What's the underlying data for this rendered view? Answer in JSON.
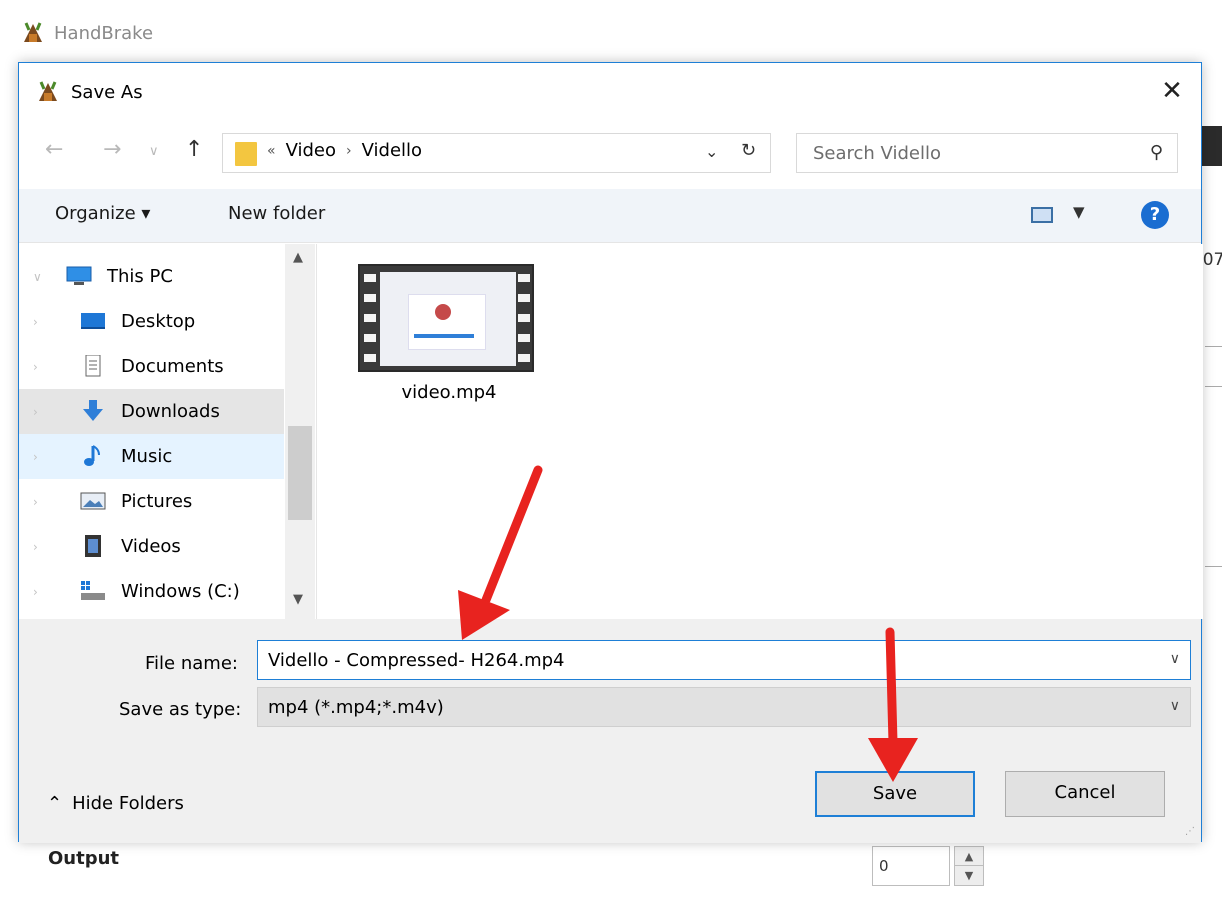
{
  "background_app": {
    "title": "HandBrake",
    "edge_text": ":07",
    "output_label": "Output",
    "spinner_value": "0"
  },
  "dialog": {
    "title": "Save As",
    "address": {
      "crumb_prefix": "«",
      "crumbs": [
        "Video",
        "Vidello"
      ]
    },
    "search_placeholder": "Search Vidello",
    "toolbar": {
      "organize": "Organize ▾",
      "new_folder": "New folder"
    },
    "tree": [
      {
        "label": "This PC",
        "icon": "monitor-icon"
      },
      {
        "label": "Desktop",
        "icon": "desktop-icon"
      },
      {
        "label": "Documents",
        "icon": "documents-icon"
      },
      {
        "label": "Downloads",
        "icon": "downloads-icon"
      },
      {
        "label": "Music",
        "icon": "music-icon"
      },
      {
        "label": "Pictures",
        "icon": "pictures-icon"
      },
      {
        "label": "Videos",
        "icon": "videos-icon"
      },
      {
        "label": "Windows (C:)",
        "icon": "drive-icon"
      }
    ],
    "files": [
      {
        "name": "video.mp4"
      }
    ],
    "file_name_label": "File name:",
    "file_name_value": "Vidello - Compressed- H264.mp4",
    "save_type_label": "Save as type:",
    "save_type_value": "mp4 (*.mp4;*.m4v)",
    "hide_folders": "Hide Folders",
    "save_button": "Save",
    "cancel_button": "Cancel"
  },
  "colors": {
    "accent": "#1e7fd6",
    "arrow": "#e8231f",
    "selection": "#e5e5e5"
  }
}
